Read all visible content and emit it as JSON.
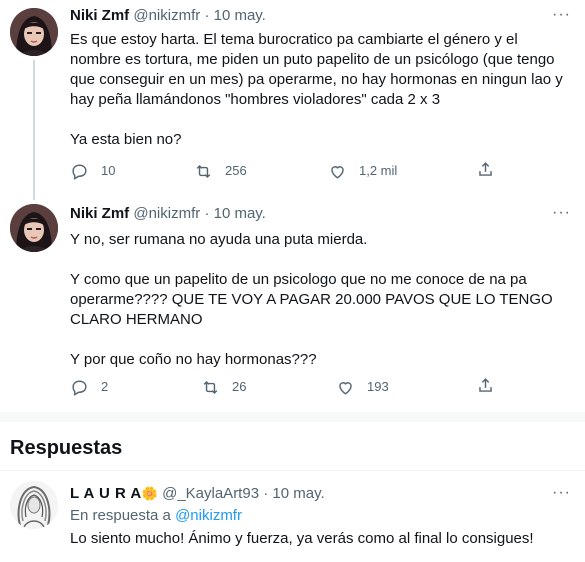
{
  "tweets": [
    {
      "author_name": "Niki Zmf",
      "author_handle": "@nikizmfr",
      "separator": "·",
      "date": "10 may.",
      "paragraphs": [
        "Es que estoy harta. El tema burocratico pa cambiarte el género y el nombre es tortura, me piden un puto papelito de un psicólogo (que tengo que conseguir en un mes) pa operarme, no hay hormonas en ningun lao y hay peña llamándonos \"hombres violadores\" cada 2 x 3",
        "Ya esta bien no?"
      ],
      "reply_count": "10",
      "retweet_count": "256",
      "like_count": "1,2 mil"
    },
    {
      "author_name": "Niki Zmf",
      "author_handle": "@nikizmfr",
      "separator": "·",
      "date": "10 may.",
      "paragraphs": [
        "Y no, ser rumana no ayuda una puta mierda.",
        "Y como que un papelito de un psicologo que no me conoce de na pa operarme???? QUE TE VOY A PAGAR 20.000 PAVOS QUE LO TENGO CLARO HERMANO",
        "Y por que coño no hay hormonas???"
      ],
      "reply_count": "2",
      "retweet_count": "26",
      "like_count": "193"
    }
  ],
  "replies_section": {
    "title": "Respuestas"
  },
  "reply": {
    "author_name": "L A U R A",
    "author_emoji": "🌼",
    "author_handle": "@_KaylaArt93",
    "separator": "·",
    "date": "10 may.",
    "reply_prefix": "En respuesta a",
    "reply_target": "@nikizmfr",
    "text": "Lo siento mucho! Ánimo y fuerza, ya verás como al final lo consigues!"
  },
  "more_label": "···",
  "colors": {
    "text": "#0f1419",
    "secondary": "#536471",
    "accent": "#1d9bf0",
    "divider": "#eff3f4"
  },
  "icons": [
    "reply-icon",
    "retweet-icon",
    "like-icon",
    "share-icon",
    "more-icon"
  ]
}
